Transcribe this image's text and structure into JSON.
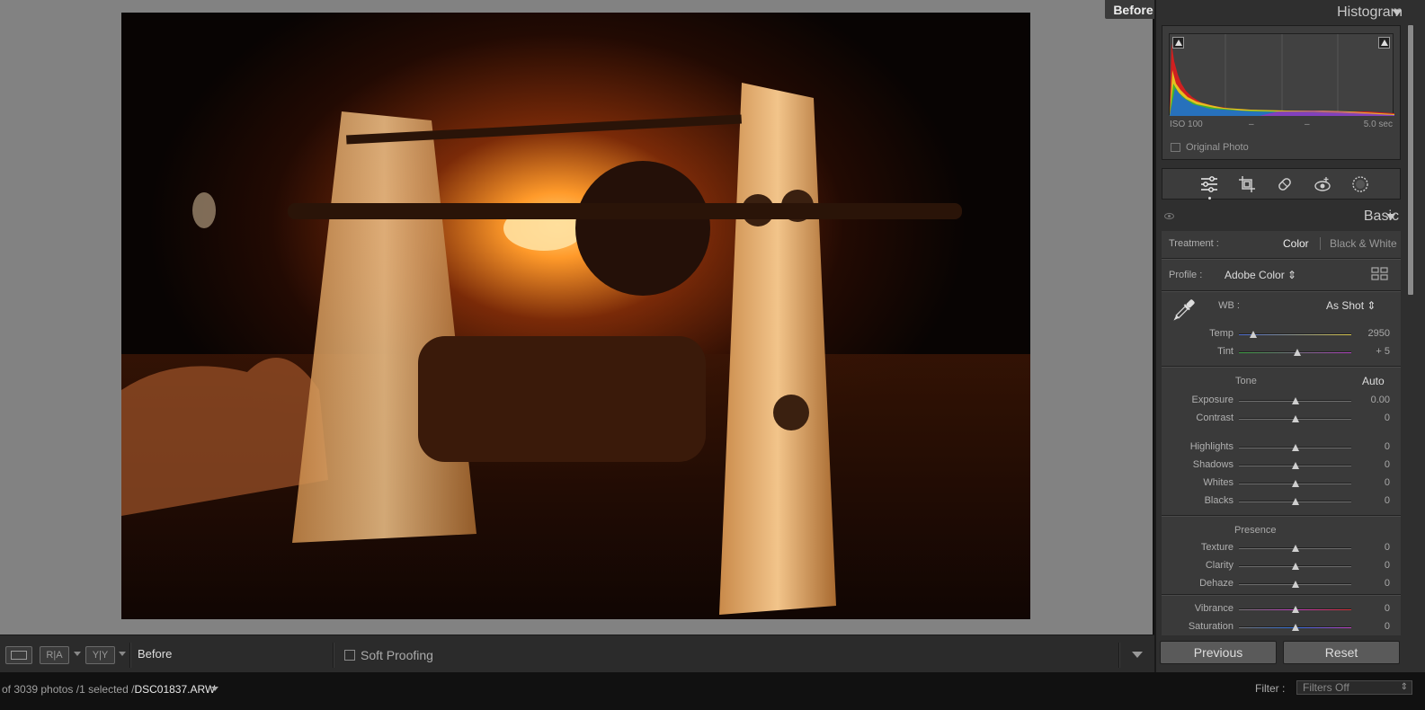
{
  "viewport": {
    "before_tag": "Before",
    "photo_description_icon": "photo-icon"
  },
  "toolbar": {
    "view_mode_label": "Before",
    "ra_label": "R|A",
    "yy_label": "Y|Y",
    "soft_proofing_label": "Soft Proofing",
    "soft_proofing_checked": false
  },
  "histogram": {
    "title": "Histogram",
    "iso": "ISO 100",
    "dash1": "–",
    "dash2": "–",
    "shutter": "5.0 sec",
    "original_photo_label": "Original Photo"
  },
  "tools": {
    "items": [
      "edit-sliders-icon",
      "crop-icon",
      "healing-icon",
      "red-eye-icon",
      "masking-icon"
    ]
  },
  "basic": {
    "title": "Basic",
    "treatment_label": "Treatment :",
    "treatment_color": "Color",
    "treatment_bw": "Black & White",
    "profile_label": "Profile :",
    "profile_value": "Adobe Color ⇕",
    "wb_label": "WB :",
    "wb_value": "As Shot ⇕",
    "temp": {
      "label": "Temp",
      "value": "2950",
      "position": 0.13
    },
    "tint": {
      "label": "Tint",
      "value": "+ 5",
      "position": 0.52
    },
    "tone_label": "Tone",
    "auto_label": "Auto",
    "exposure": {
      "label": "Exposure",
      "value": "0.00",
      "position": 0.5
    },
    "contrast": {
      "label": "Contrast",
      "value": "0",
      "position": 0.5
    },
    "highlights": {
      "label": "Highlights",
      "value": "0",
      "position": 0.5
    },
    "shadows": {
      "label": "Shadows",
      "value": "0",
      "position": 0.5
    },
    "whites": {
      "label": "Whites",
      "value": "0",
      "position": 0.5
    },
    "blacks": {
      "label": "Blacks",
      "value": "0",
      "position": 0.5
    },
    "presence_label": "Presence",
    "texture": {
      "label": "Texture",
      "value": "0",
      "position": 0.5
    },
    "clarity": {
      "label": "Clarity",
      "value": "0",
      "position": 0.5
    },
    "dehaze": {
      "label": "Dehaze",
      "value": "0",
      "position": 0.5
    },
    "vibrance": {
      "label": "Vibrance",
      "value": "0",
      "position": 0.5
    },
    "saturation": {
      "label": "Saturation",
      "value": "0",
      "position": 0.5
    }
  },
  "nav": {
    "previous_label": "Previous",
    "reset_label": "Reset"
  },
  "status": {
    "count_text": "of 3039 photos /1 selected /",
    "filename": "DSC01837.ARW",
    "filter_label": "Filter :",
    "filter_value": "Filters Off"
  }
}
